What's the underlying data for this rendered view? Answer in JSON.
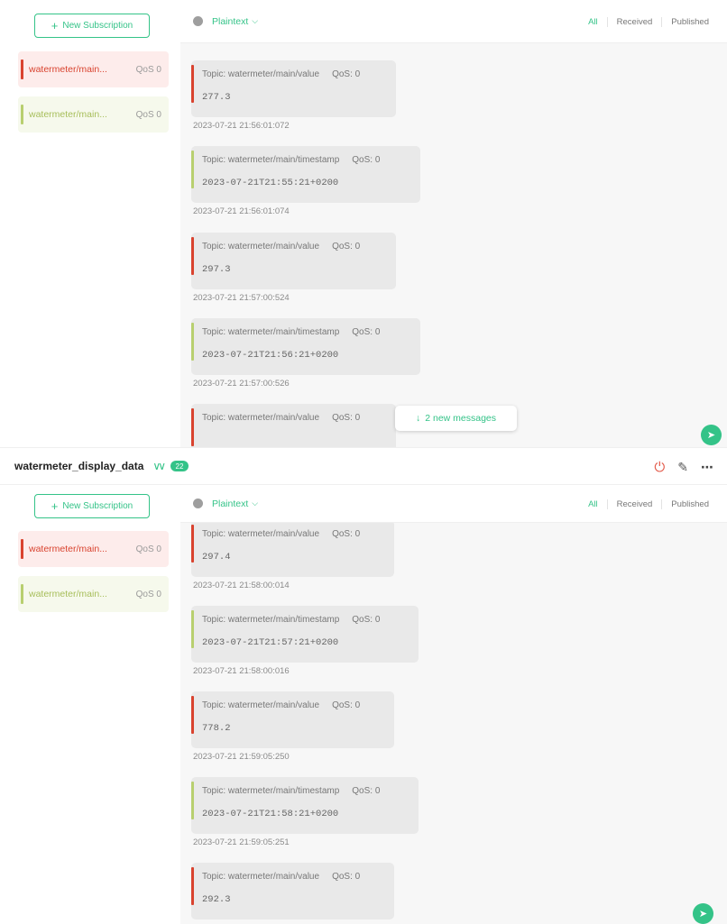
{
  "top": {
    "new_subscription_label": "New Subscription",
    "subscriptions": [
      {
        "topic": "watermeter/main...",
        "qos": "QoS 0",
        "color": "#d9432f"
      },
      {
        "topic": "watermeter/main...",
        "qos": "QoS 0",
        "color": "#b8cf6f"
      }
    ],
    "toolbar": {
      "format": "Plaintext",
      "filters": [
        "All",
        "Received",
        "Published"
      ]
    },
    "messages": [
      {
        "topic": "Topic: watermeter/main/value",
        "qos": "QoS: 0",
        "payload": "277.3",
        "time": "2023-07-21 21:56:01:072"
      },
      {
        "topic": "Topic: watermeter/main/timestamp",
        "qos": "QoS: 0",
        "payload": "2023-07-21T21:55:21+0200",
        "time": "2023-07-21 21:56:01:074"
      },
      {
        "topic": "Topic: watermeter/main/value",
        "qos": "QoS: 0",
        "payload": "297.3",
        "time": "2023-07-21 21:57:00:524"
      },
      {
        "topic": "Topic: watermeter/main/timestamp",
        "qos": "QoS: 0",
        "payload": "2023-07-21T21:56:21+0200",
        "time": "2023-07-21 21:57:00:526"
      },
      {
        "topic": "Topic: watermeter/main/value",
        "qos": "QoS: 0",
        "payload": "",
        "time": ""
      }
    ],
    "new_messages_label": "2 new messages"
  },
  "connection": {
    "name": "watermeter_display_data",
    "badge": "22"
  },
  "bottom": {
    "new_subscription_label": "New Subscription",
    "subscriptions": [
      {
        "topic": "watermeter/main...",
        "qos": "QoS 0",
        "color": "#d9432f"
      },
      {
        "topic": "watermeter/main...",
        "qos": "QoS 0",
        "color": "#b8cf6f"
      }
    ],
    "toolbar": {
      "format": "Plaintext",
      "filters": [
        "All",
        "Received",
        "Published"
      ]
    },
    "messages": [
      {
        "topic": "Topic: watermeter/main/value",
        "qos": "QoS: 0",
        "payload": "297.4",
        "time": "2023-07-21 21:58:00:014"
      },
      {
        "topic": "Topic: watermeter/main/timestamp",
        "qos": "QoS: 0",
        "payload": "2023-07-21T21:57:21+0200",
        "time": "2023-07-21 21:58:00:016"
      },
      {
        "topic": "Topic: watermeter/main/value",
        "qos": "QoS: 0",
        "payload": "778.2",
        "time": "2023-07-21 21:59:05:250"
      },
      {
        "topic": "Topic: watermeter/main/timestamp",
        "qos": "QoS: 0",
        "payload": "2023-07-21T21:58:21+0200",
        "time": "2023-07-21 21:59:05:251"
      },
      {
        "topic": "Topic: watermeter/main/value",
        "qos": "QoS: 0",
        "payload": "292.3",
        "time": ""
      }
    ]
  }
}
